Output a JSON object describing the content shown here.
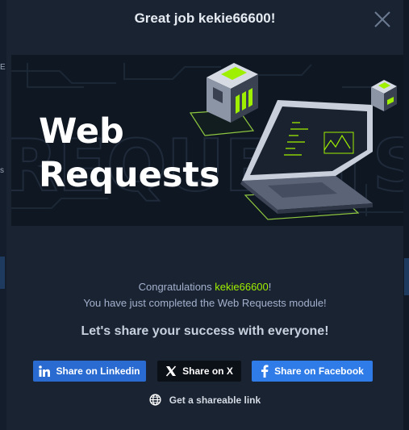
{
  "modal": {
    "title": "Great job kekie66600!",
    "banner_line1": "Web",
    "banner_line2": "Requests",
    "congrats_prefix": "Congratulations ",
    "username": "kekie66600",
    "congrats_suffix": "!",
    "completed_text": "You have just completed the Web Requests module!",
    "share_heading": "Let's share your success with everyone!",
    "buttons": {
      "linkedin": "Share on Linkedin",
      "x": "Share on X",
      "facebook": "Share on Facebook"
    },
    "share_link": "Get a shareable link"
  },
  "colors": {
    "accent_green": "#9fef00",
    "linkedin_blue": "#2a6bd1",
    "facebook_blue": "#2f7ce8",
    "x_black": "#0b0f16",
    "modal_bg": "#1a2332"
  },
  "icons": [
    "close-icon",
    "linkedin-icon",
    "x-icon",
    "facebook-icon",
    "globe-icon"
  ]
}
